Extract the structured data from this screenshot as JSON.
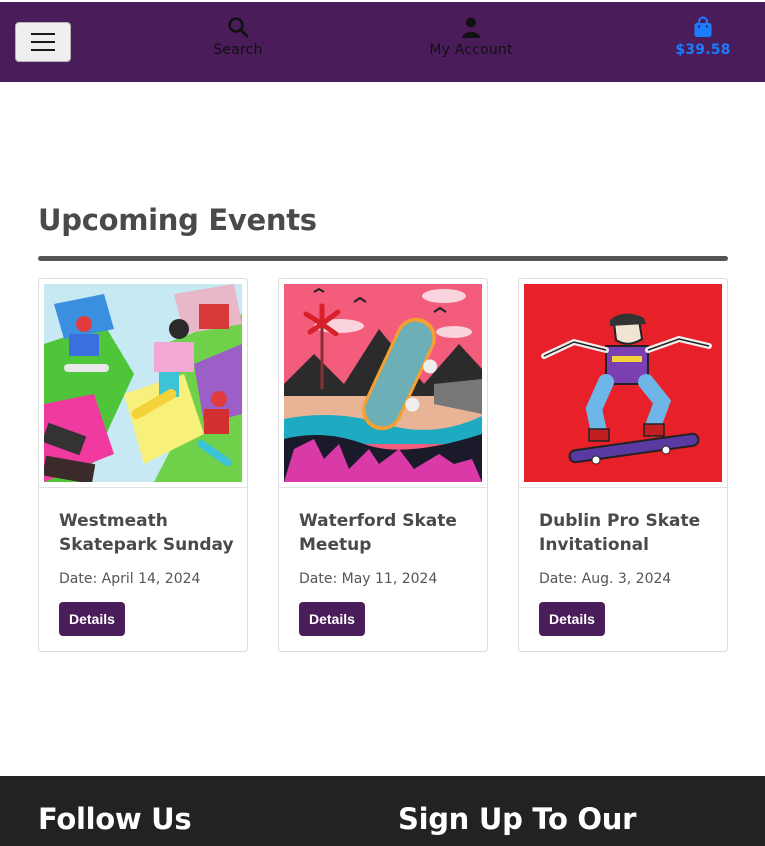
{
  "header": {
    "search_label": "Search",
    "account_label": "My Account",
    "cart_total": "$39.58",
    "menu_icon": "hamburger-icon",
    "search_icon": "search-icon",
    "account_icon": "user-icon",
    "cart_icon": "shopping-bag-icon",
    "brand_color": "#4b1c5a",
    "cart_color": "#1a7cff"
  },
  "events": {
    "heading": "Upcoming Events",
    "items": [
      {
        "title": "Westmeath Skatepark Sunday",
        "date": "Date: April 14, 2024",
        "button": "Details"
      },
      {
        "title": "Waterford Skate Meetup",
        "date": "Date: May 11, 2024",
        "button": "Details"
      },
      {
        "title": "Dublin Pro Skate Invitational",
        "date": "Date: Aug. 3, 2024",
        "button": "Details"
      }
    ]
  },
  "footer": {
    "follow_heading": "Follow Us",
    "signup_heading": "Sign Up To Our"
  }
}
